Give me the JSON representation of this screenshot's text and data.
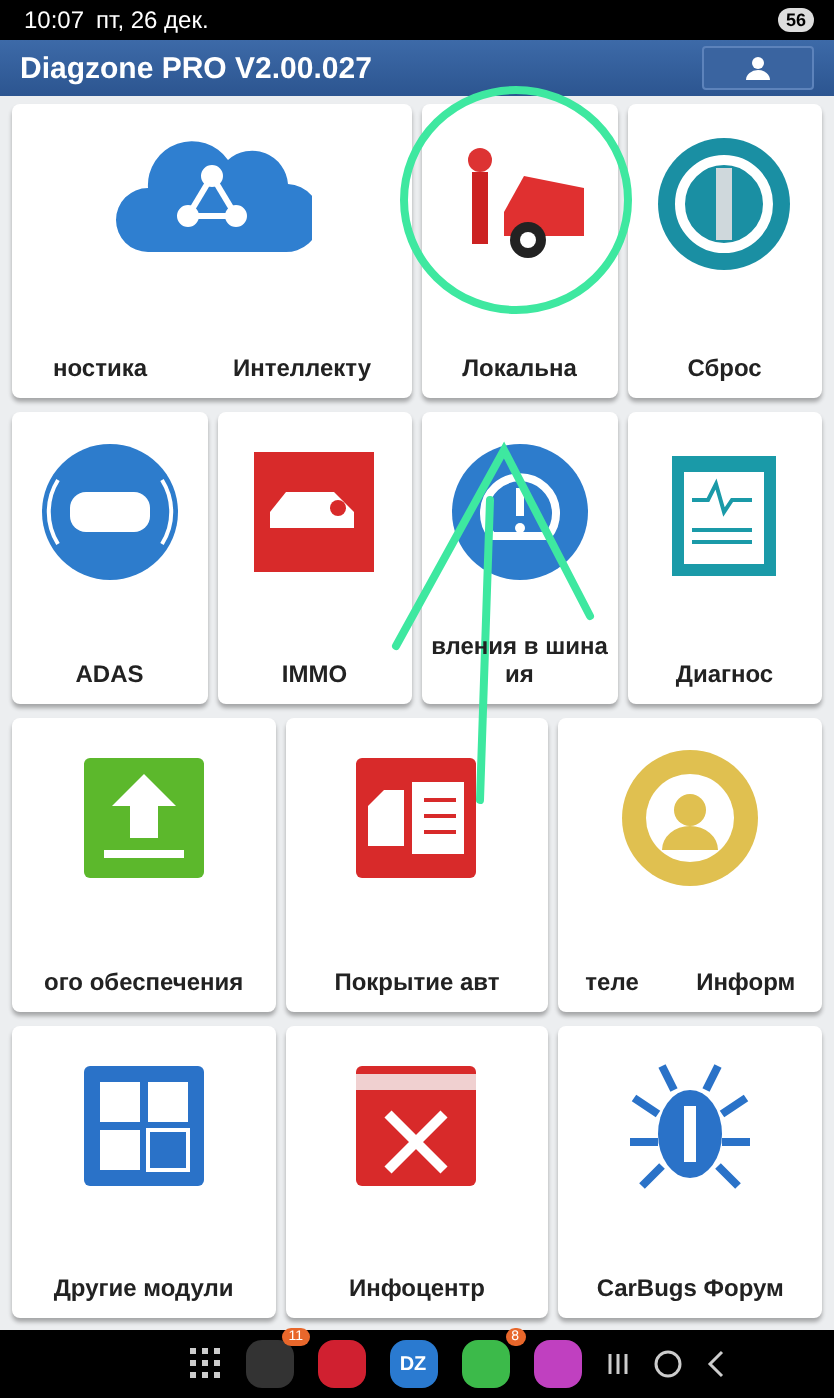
{
  "status_bar": {
    "time": "10:07",
    "date": "пт, 26 дек.",
    "battery": "56"
  },
  "header": {
    "title": "Diagzone PRO V2.00.027"
  },
  "rows": [
    {
      "tiles": [
        {
          "labels": [
            "ностика",
            "Интеллекту"
          ]
        },
        {
          "labels": [
            "Локальна"
          ]
        },
        {
          "labels": [
            "Сброс"
          ]
        }
      ]
    },
    {
      "tiles": [
        {
          "labels": [
            "ADAS"
          ]
        },
        {
          "labels": [
            "IMMO"
          ]
        },
        {
          "labels": [
            "вления в шина",
            "ия"
          ]
        },
        {
          "labels": [
            "Диагнос"
          ]
        }
      ]
    },
    {
      "tiles": [
        {
          "labels": [
            "ого обеспечения"
          ]
        },
        {
          "labels": [
            "Покрытие авт"
          ]
        },
        {
          "labels": [
            "теле",
            "Информ"
          ]
        }
      ]
    },
    {
      "tiles": [
        {
          "labels": [
            "Другие модули"
          ]
        },
        {
          "labels": [
            "Инфоцентр"
          ]
        },
        {
          "labels": [
            "CarBugs Форум"
          ]
        }
      ]
    }
  ],
  "taskbar": {
    "app_label": "DZ",
    "badges": [
      "11",
      "8"
    ]
  }
}
